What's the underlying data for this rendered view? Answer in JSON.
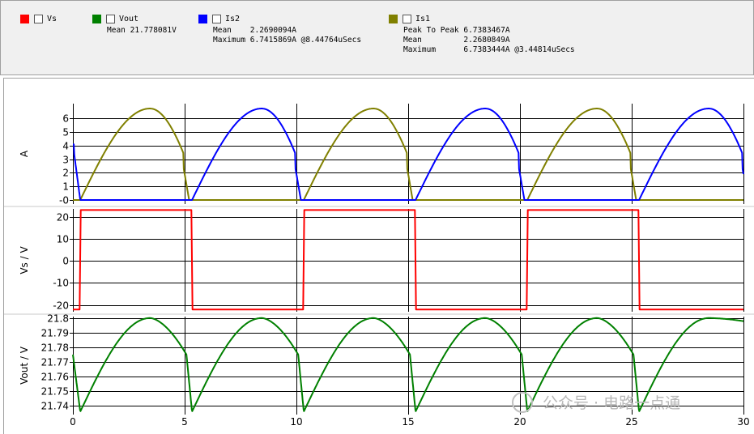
{
  "legend": [
    {
      "id": "vs",
      "name": "Vs",
      "color": "#ff0000",
      "stats": []
    },
    {
      "id": "vout",
      "name": "Vout",
      "color": "#008000",
      "stats": [
        {
          "label": "Mean ",
          "value": "21.778081V"
        }
      ]
    },
    {
      "id": "is2",
      "name": "Is2",
      "color": "#0000ff",
      "stats": [
        {
          "label": "Mean    ",
          "value": "2.2690094A"
        },
        {
          "label": "Maximum ",
          "value": "6.7415869A @8.44764uSecs"
        }
      ]
    },
    {
      "id": "is1",
      "name": "Is1",
      "color": "#808000",
      "stats": [
        {
          "label": "Peak To Peak ",
          "value": "6.7383467A"
        },
        {
          "label": "Mean         ",
          "value": "2.2680849A"
        },
        {
          "label": "Maximum      ",
          "value": "6.7383444A @3.44814uSecs"
        }
      ]
    }
  ],
  "watermark": "公众号 · 电路一点通",
  "chart_data": [
    {
      "type": "line",
      "ylabel": "A",
      "xlim": [
        0,
        30
      ],
      "ylim": [
        -0.3,
        7.1
      ],
      "yticks": [
        "6",
        "5",
        "4",
        "3",
        "2",
        "1",
        "-0"
      ],
      "ytick_values": [
        6,
        5,
        4,
        3,
        2,
        1,
        0
      ],
      "xticks": [
        "0",
        "5",
        "10",
        "15",
        "20",
        "25",
        "30"
      ],
      "xtick_values": [
        0,
        5,
        10,
        15,
        20,
        25,
        30
      ],
      "period": 10,
      "series": [
        {
          "legend": "Is1",
          "color": "#808000",
          "shape": "half-sine",
          "peak": 6.74,
          "conduct_start": [
            0.33,
            10.33,
            20.33
          ],
          "conduct_end": [
            5.2,
            15.2,
            25.2
          ],
          "peak_time": [
            3.45,
            13.45,
            23.45
          ]
        },
        {
          "legend": "Is2",
          "color": "#0000ff",
          "shape": "half-sine",
          "peak": 6.74,
          "conduct_start": [
            5.33,
            15.33,
            25.33
          ],
          "conduct_end": [
            0.2,
            10.2,
            20.2,
            30.2
          ],
          "peak_time": [
            8.45,
            18.45,
            28.45
          ]
        }
      ]
    },
    {
      "type": "line",
      "ylabel": "Vs / V",
      "xlim": [
        0,
        30
      ],
      "ylim": [
        -23,
        23.5
      ],
      "yticks": [
        "20",
        "10",
        "0",
        "-10",
        "-20"
      ],
      "ytick_values": [
        20,
        10,
        0,
        -10,
        -20
      ],
      "xticks": [
        "0",
        "5",
        "10",
        "15",
        "20",
        "25",
        "30"
      ],
      "xtick_values": [
        0,
        5,
        10,
        15,
        20,
        25,
        30
      ],
      "series": [
        {
          "legend": "Vs",
          "color": "#ff0000",
          "shape": "square",
          "high": 23,
          "low": -22,
          "rise": [
            0.3,
            10.3,
            20.3
          ],
          "fall": [
            5.3,
            15.3,
            25.3
          ]
        }
      ]
    },
    {
      "type": "line",
      "ylabel": "Vout / V",
      "xlim": [
        0,
        30
      ],
      "ylim": [
        21.734,
        21.801
      ],
      "yticks": [
        "21.8",
        "21.79",
        "21.78",
        "21.77",
        "21.76",
        "21.75",
        "21.74"
      ],
      "ytick_values": [
        21.8,
        21.79,
        21.78,
        21.77,
        21.76,
        21.75,
        21.74
      ],
      "xticks": [
        "0",
        "5",
        "10",
        "15",
        "20",
        "25",
        "30"
      ],
      "xtick_values": [
        0,
        5,
        10,
        15,
        20,
        25,
        30
      ],
      "series": [
        {
          "legend": "Vout",
          "color": "#008000",
          "shape": "ripple",
          "max": 21.8,
          "min": 21.736,
          "period": 5,
          "min_time": [
            0.33,
            5.33,
            10.33,
            15.33,
            20.33,
            25.33
          ],
          "peak_time": [
            3.45,
            8.45,
            13.45,
            18.45,
            23.45,
            28.45
          ],
          "start_value": 21.775,
          "end_value": 21.775
        }
      ]
    }
  ]
}
